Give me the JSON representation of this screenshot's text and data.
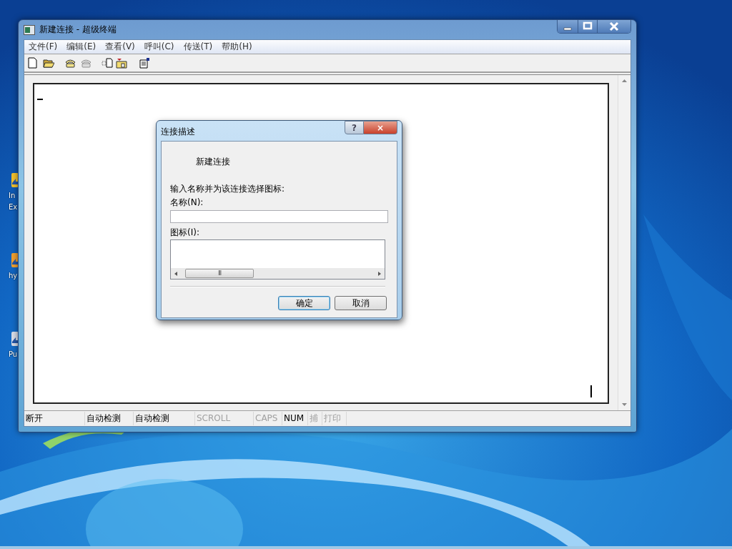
{
  "desktop_icons": [
    {
      "label": "In",
      "label_2": "Ex"
    },
    {
      "label": "hy"
    },
    {
      "label": "Pu"
    }
  ],
  "window": {
    "title": "新建连接 - 超级终端"
  },
  "menu": [
    "文件(F)",
    "编辑(E)",
    "查看(V)",
    "呼叫(C)",
    "传送(T)",
    "帮助(H)"
  ],
  "toolbar": [
    {
      "kind": "document",
      "disabled": false
    },
    {
      "kind": "folder",
      "disabled": false
    },
    {
      "kind": "phone",
      "disabled": false
    },
    {
      "kind": "phone",
      "disabled": true
    },
    {
      "kind": "new-window",
      "disabled": false
    },
    {
      "kind": "folder-up",
      "disabled": false
    },
    {
      "kind": "properties",
      "disabled": false
    }
  ],
  "status_bar": [
    {
      "text": "断开",
      "disabled": false
    },
    {
      "text": "自动检测",
      "disabled": false
    },
    {
      "text": "自动检测",
      "disabled": false
    },
    {
      "text": "SCROLL",
      "disabled": true
    },
    {
      "text": "CAPS",
      "disabled": true
    },
    {
      "text": "NUM",
      "disabled": false
    },
    {
      "text": "捕",
      "disabled": true
    },
    {
      "text": "打印",
      "disabled": true
    }
  ],
  "dialog": {
    "title": "连接描述",
    "help": "?",
    "close": "×",
    "heading": "新建连接",
    "prompt": "输入名称并为该连接选择图标:",
    "name_label": "名称(N):",
    "icon_label": "图标(I):",
    "scroll_grip": "III",
    "buttons": [
      {
        "label": "确定",
        "default": true
      },
      {
        "label": "取消",
        "default": false
      }
    ]
  }
}
